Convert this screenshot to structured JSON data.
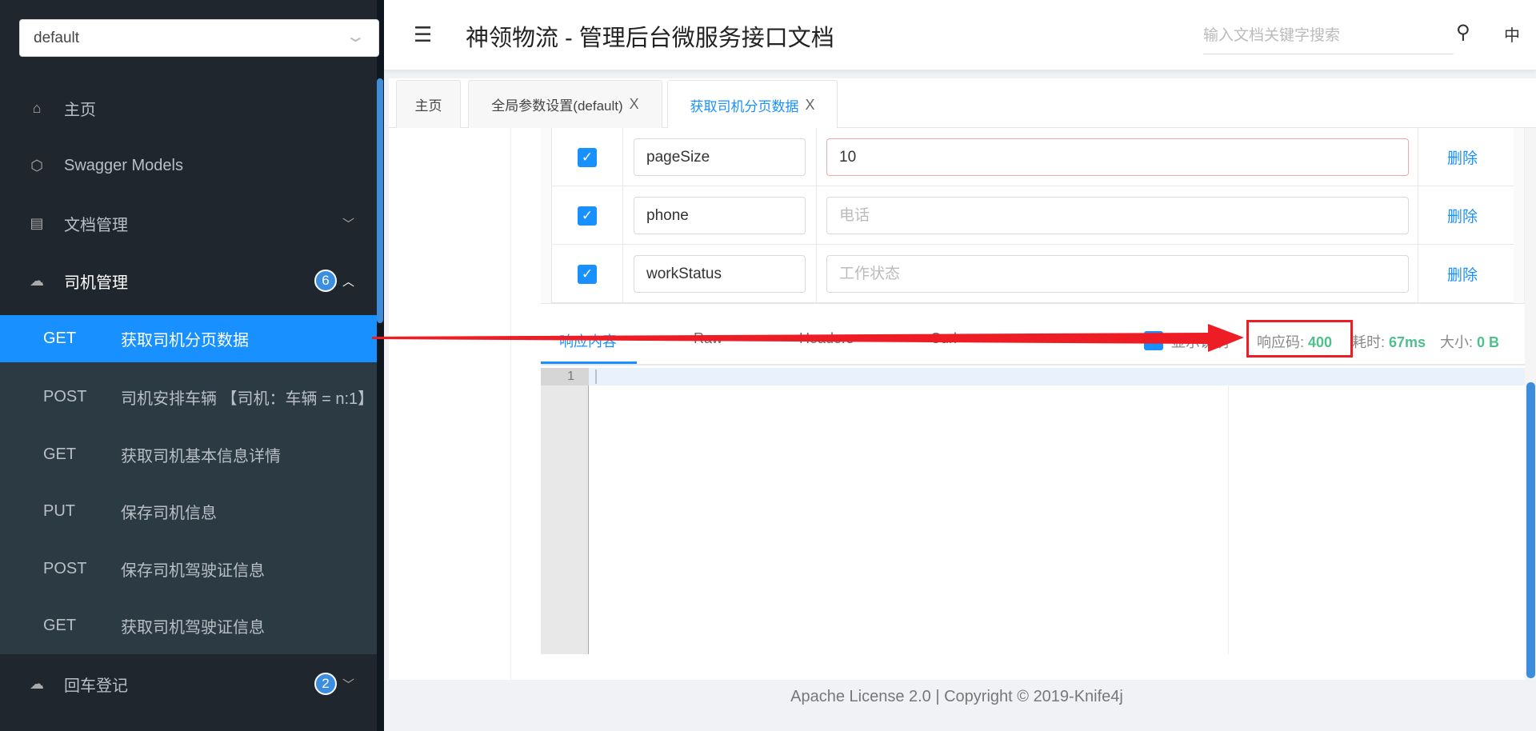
{
  "sidebar": {
    "group_select": "default",
    "items": [
      {
        "label": "主页",
        "icon": "home-icon"
      },
      {
        "label": "Swagger Models",
        "icon": "cube-icon"
      },
      {
        "label": "文档管理",
        "icon": "document-settings-icon"
      },
      {
        "label": "司机管理",
        "icon": "cloud-api-icon",
        "badge": "6"
      },
      {
        "label": "回车登记",
        "icon": "cloud-api-icon",
        "badge": "2"
      }
    ],
    "endpoints": [
      {
        "method": "GET",
        "label": "获取司机分页数据"
      },
      {
        "method": "POST",
        "label": "司机安排车辆 【司机：车辆 = n:1】"
      },
      {
        "method": "GET",
        "label": "获取司机基本信息详情"
      },
      {
        "method": "PUT",
        "label": "保存司机信息"
      },
      {
        "method": "POST",
        "label": "保存司机驾驶证信息"
      },
      {
        "method": "GET",
        "label": "获取司机驾驶证信息"
      }
    ]
  },
  "header": {
    "title": "神领物流 - 管理后台微服务接口文档",
    "search_placeholder": "输入文档关键字搜索",
    "lang": "中"
  },
  "tabs": [
    {
      "label": "主页"
    },
    {
      "label": "全局参数设置(default)",
      "close": "X"
    },
    {
      "label": "获取司机分页数据",
      "close": "X"
    }
  ],
  "params": [
    {
      "name": "pageSize",
      "value": "10",
      "placeholder": "",
      "action": "删除"
    },
    {
      "name": "phone",
      "value": "",
      "placeholder": "电话",
      "action": "删除"
    },
    {
      "name": "workStatus",
      "value": "",
      "placeholder": "工作状态",
      "action": "删除"
    }
  ],
  "response": {
    "tabs": [
      "响应内容",
      "Raw",
      "Headers",
      "Curl"
    ],
    "show_desc": "显示说明",
    "code_label": "响应码:",
    "code": "400",
    "time_label": "耗时:",
    "time": "67ms",
    "size_label": "大小:",
    "size": "0 B",
    "line_number": "1"
  },
  "footer": "Apache License 2.0 | Copyright © 2019-Knife4j",
  "colors": {
    "accent": "#1890ff",
    "success": "#4fc08d",
    "annotation": "#ee1c25",
    "sidebar": "#1f262d"
  }
}
